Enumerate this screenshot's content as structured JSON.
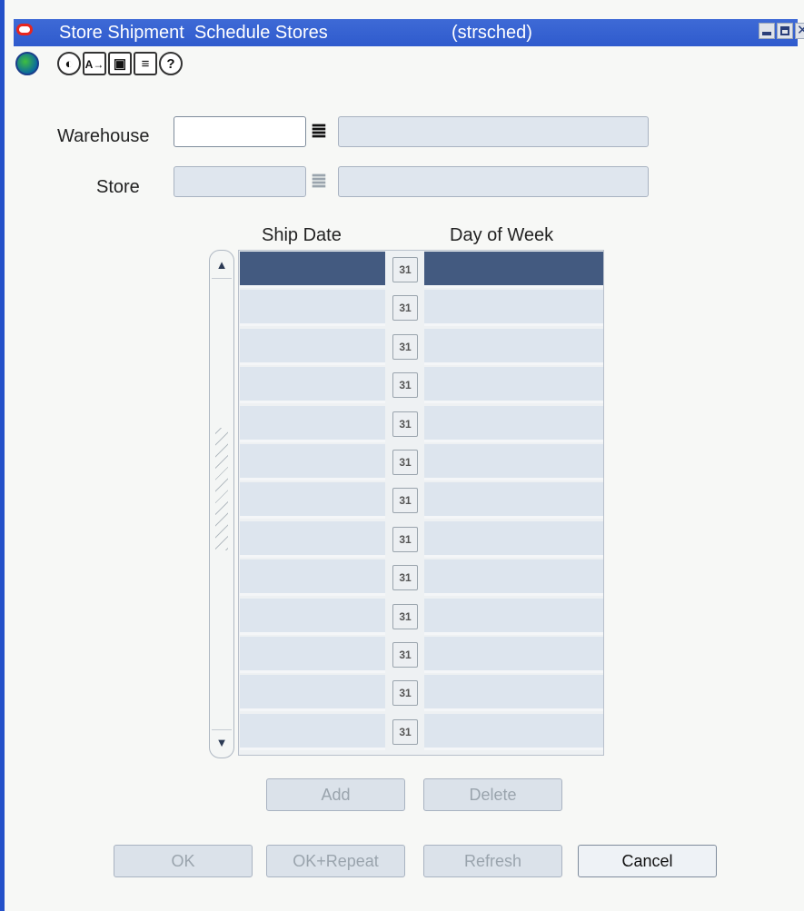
{
  "window": {
    "title": "Store Shipment  Schedule Stores",
    "code": "(strsched)"
  },
  "toolbar": {
    "icons": [
      "globe-icon",
      "navigate-icon",
      "font-icon",
      "calendar-icon",
      "notepad-icon",
      "help-icon"
    ]
  },
  "form": {
    "warehouse_label": "Warehouse",
    "warehouse_value": "",
    "warehouse_desc": "",
    "store_label": "Store",
    "store_value": "",
    "store_desc": ""
  },
  "table": {
    "columns": [
      "Ship Date",
      "Day of Week"
    ],
    "calendar_label": "31",
    "rows": [
      {
        "ship_date": "",
        "day_of_week": ""
      },
      {
        "ship_date": "",
        "day_of_week": ""
      },
      {
        "ship_date": "",
        "day_of_week": ""
      },
      {
        "ship_date": "",
        "day_of_week": ""
      },
      {
        "ship_date": "",
        "day_of_week": ""
      },
      {
        "ship_date": "",
        "day_of_week": ""
      },
      {
        "ship_date": "",
        "day_of_week": ""
      },
      {
        "ship_date": "",
        "day_of_week": ""
      },
      {
        "ship_date": "",
        "day_of_week": ""
      },
      {
        "ship_date": "",
        "day_of_week": ""
      },
      {
        "ship_date": "",
        "day_of_week": ""
      },
      {
        "ship_date": "",
        "day_of_week": ""
      },
      {
        "ship_date": "",
        "day_of_week": ""
      }
    ]
  },
  "buttons": {
    "add": "Add",
    "delete": "Delete",
    "ok": "OK",
    "ok_repeat": "OK+Repeat",
    "refresh": "Refresh",
    "cancel": "Cancel"
  },
  "colors": {
    "titlebar": "#2f5bcd",
    "selected_row": "#435a80",
    "cell": "#dde5ee"
  }
}
